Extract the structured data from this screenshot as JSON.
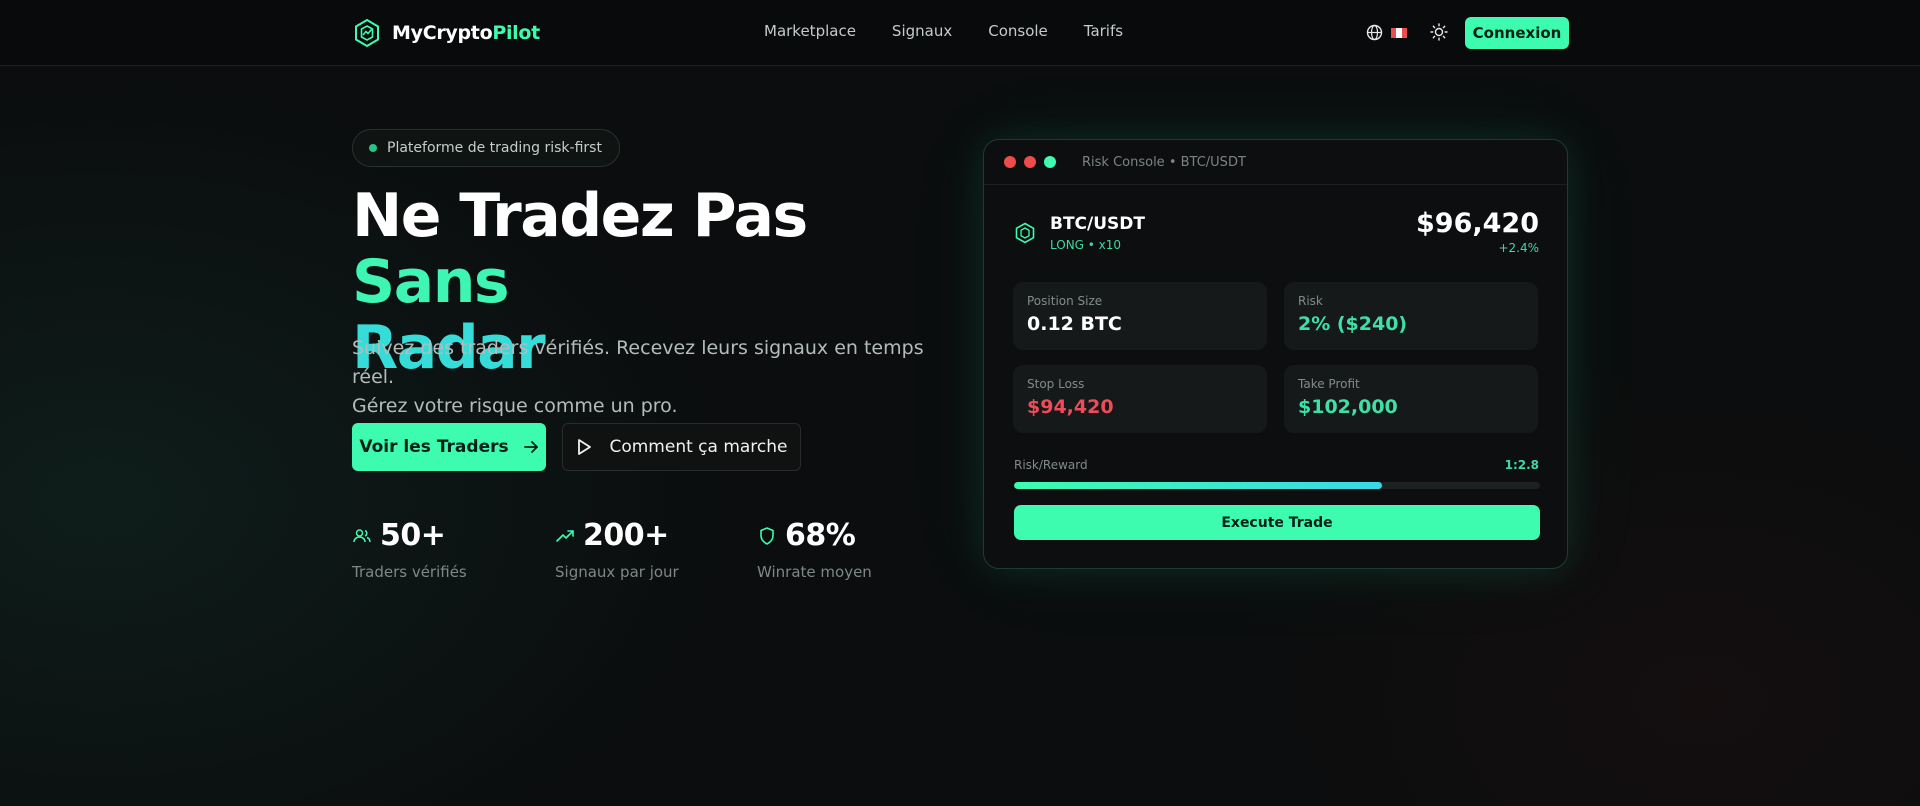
{
  "header": {
    "brand": {
      "prefix": "MyCrypto",
      "accent": "Pilot"
    },
    "nav": [
      {
        "label": "Marketplace"
      },
      {
        "label": "Signaux"
      },
      {
        "label": "Console"
      },
      {
        "label": "Tarifs"
      }
    ],
    "language_icon": "globe-icon",
    "flag_colors": [
      "#e94d4d",
      "#ffffff",
      "#e94d4d"
    ],
    "theme_icon": "sun-icon",
    "login_label": "Connexion"
  },
  "hero": {
    "badge": "Plateforme de trading risk-first",
    "title": {
      "part1": "Ne Tradez Pas ",
      "part2": "Sans",
      "part3": "Radar"
    },
    "subtitle_line1": "Suivez des traders vérifiés. Recevez leurs signaux en temps réel.",
    "subtitle_line2": "Gérez votre risque comme un pro.",
    "cta_primary": "Voir les Traders",
    "cta_secondary": "Comment ça marche",
    "stats": [
      {
        "icon": "users-icon",
        "value": "50+",
        "label": "Traders vérifiés"
      },
      {
        "icon": "trending-up-icon",
        "value": "200+",
        "label": "Signaux par jour"
      },
      {
        "icon": "shield-icon",
        "value": "68%",
        "label": "Winrate moyen"
      }
    ]
  },
  "console": {
    "window_title": "Risk Console • BTC/USDT",
    "window_dots": [
      "#f04b4b",
      "#f04b4b",
      "#3dfcb0"
    ],
    "pair": "BTC/USDT",
    "side": "LONG • x10",
    "price": "$96,420",
    "change": "+2.4%",
    "tiles": [
      {
        "label": "Position Size",
        "value": "0.12 BTC",
        "color": "#ffffff"
      },
      {
        "label": "Risk",
        "value": "2% ($240)",
        "color": "#3fe0a6"
      },
      {
        "label": "Stop Loss",
        "value": "$94,420",
        "color": "#ef4c5a"
      },
      {
        "label": "Take Profit",
        "value": "$102,000",
        "color": "#3fe0a6"
      }
    ],
    "rr_label": "Risk/Reward",
    "rr_value": "1:2.8",
    "rr_fill_fraction": 0.7,
    "execute_label": "Execute Trade"
  },
  "colors": {
    "accent": "#3dfcb0",
    "accent_cyan": "#36dcd8",
    "loss": "#ef4c5a",
    "background": "#0b0d0e"
  }
}
